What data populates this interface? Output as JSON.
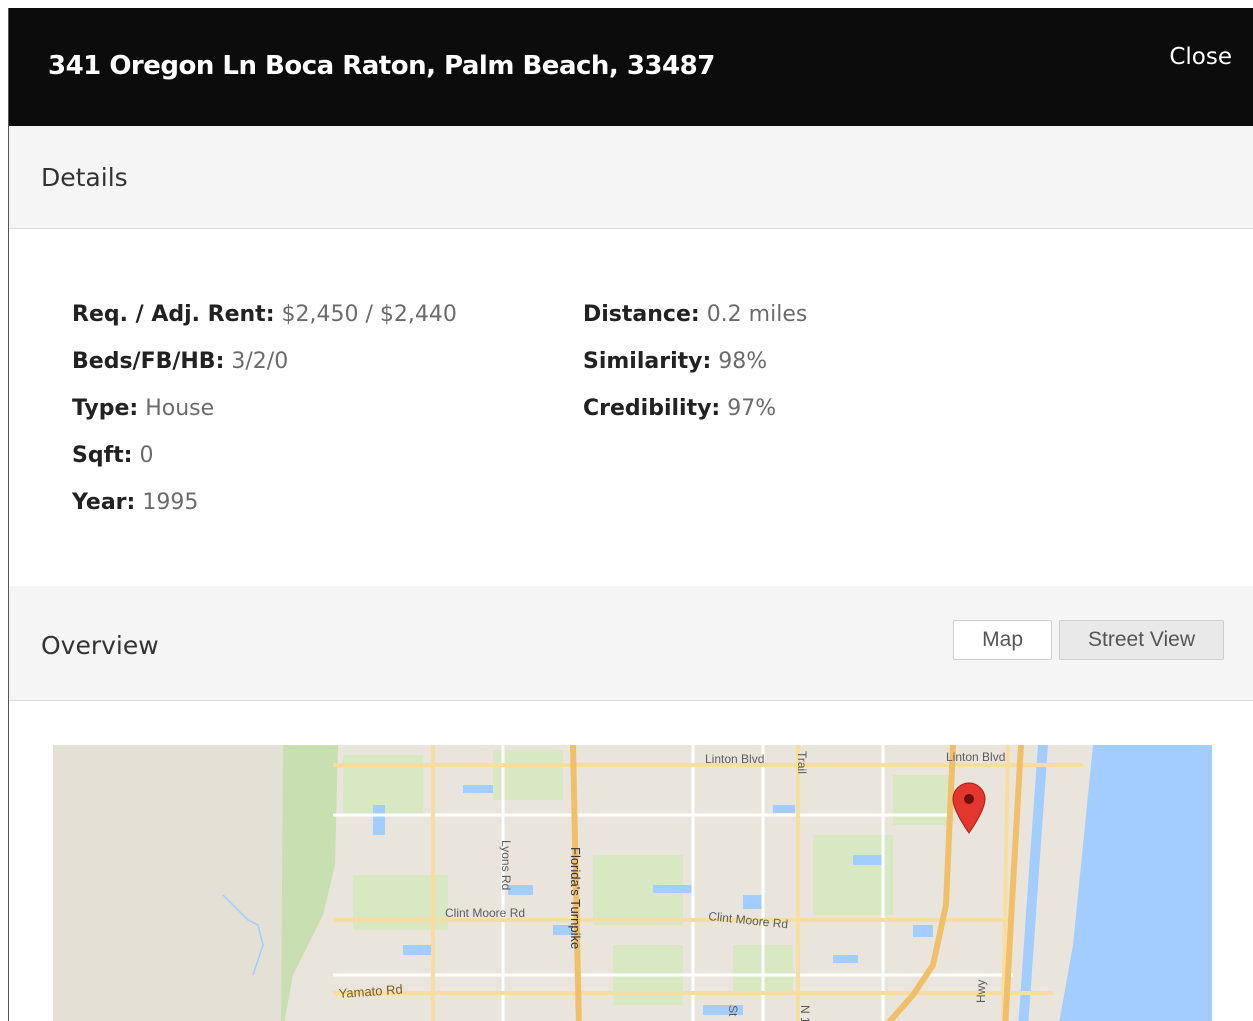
{
  "modal": {
    "title": "341 Oregon Ln Boca Raton, Palm Beach, 33487",
    "close_label": "Close"
  },
  "details": {
    "section_title": "Details",
    "left": [
      {
        "label": "Req. / Adj. Rent:",
        "value": "$2,450 / $2,440"
      },
      {
        "label": "Beds/FB/HB:",
        "value": "3/2/0"
      },
      {
        "label": "Type:",
        "value": "House"
      },
      {
        "label": "Sqft:",
        "value": "0"
      },
      {
        "label": "Year:",
        "value": "1995"
      }
    ],
    "right": [
      {
        "label": "Distance:",
        "value": "0.2 miles"
      },
      {
        "label": "Similarity:",
        "value": "98%"
      },
      {
        "label": "Credibility:",
        "value": "97%"
      }
    ]
  },
  "overview": {
    "section_title": "Overview",
    "map_button": "Map",
    "street_view_button": "Street View",
    "map": {
      "road_labels": {
        "linton_w": "Linton Blvd",
        "linton_e": "Linton Blvd",
        "trail": "Trail",
        "lyons": "Lyons Rd",
        "turnpike": "Florida's Turnpike",
        "clint_moore_w": "Clint Moore Rd",
        "clint_moore_e": "Clint Moore Rd",
        "yamato": "Yamato Rd",
        "st": "St",
        "n1": "N 1",
        "hwy": "Hwy"
      },
      "marker_icon": "map-pin-icon",
      "colors": {
        "water": "#a3ccff",
        "park": "#c8dfb1",
        "highway": "#f0bf6a",
        "road": "#f7dea0",
        "land": "#e9e5dc",
        "marker": "#e2362e"
      }
    }
  }
}
